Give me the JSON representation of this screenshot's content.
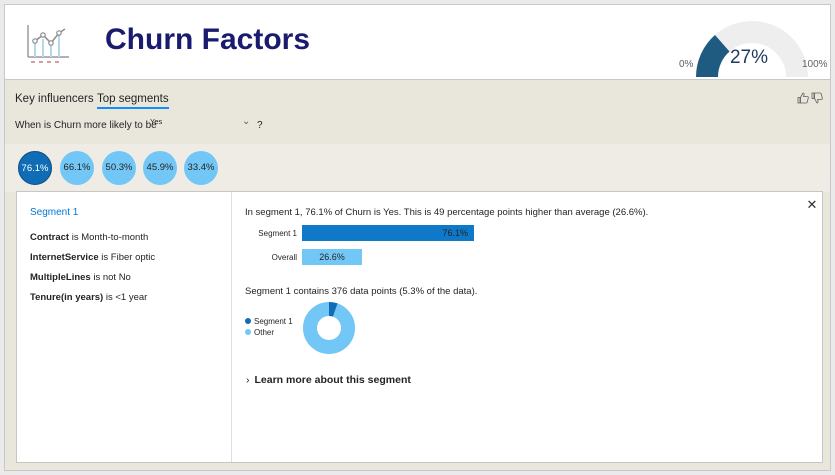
{
  "header": {
    "title": "Churn Factors",
    "logo_icon": "line-chart-icon",
    "gauge": {
      "value": 0.27,
      "value_label": "27%",
      "min_label": "0%",
      "max_label": "100%",
      "fill_color": "#1f5a80",
      "track_color": "#eeeeee"
    }
  },
  "visual": {
    "tabs": [
      {
        "label": "Key influencers",
        "active": false
      },
      {
        "label": "Top segments",
        "active": true
      }
    ],
    "question": {
      "label": "When is Churn more likely to be",
      "value": "Yes",
      "help": "?"
    },
    "feedback_icons": [
      "thumbs-up-icon",
      "thumbs-down-icon"
    ],
    "segments": [
      {
        "label": "76.1%",
        "active": true
      },
      {
        "label": "66.1%",
        "active": false
      },
      {
        "label": "50.3%",
        "active": false
      },
      {
        "label": "45.9%",
        "active": false
      },
      {
        "label": "33.4%",
        "active": false
      }
    ]
  },
  "detail": {
    "segment_title": "Segment 1",
    "conditions": [
      {
        "field": "Contract",
        "text": " is Month-to-month"
      },
      {
        "field": "InternetService",
        "text": " is Fiber optic"
      },
      {
        "field": "MultipleLines",
        "text": " is not No"
      },
      {
        "field": "Tenure(in years)",
        "text": " is <1 year"
      }
    ],
    "description": "In segment 1, 76.1% of Churn is Yes. This is 49 percentage points higher than average (26.6%).",
    "bars": [
      {
        "label": "Segment 1",
        "value": 76.1,
        "value_label": "76.1%",
        "color": "#0f78c8"
      },
      {
        "label": "Overall",
        "value": 26.6,
        "value_label": "26.6%",
        "color": "#72c7f6"
      }
    ],
    "points_text": "Segment 1 contains 376 data points (5.3% of the data).",
    "donut": {
      "share": 0.053,
      "legend": [
        {
          "label": "Segment 1",
          "color": "#0f6cb5"
        },
        {
          "label": "Other",
          "color": "#72c7f6"
        }
      ]
    },
    "learn_more": "Learn more about this segment",
    "close_icon": "close-icon"
  }
}
